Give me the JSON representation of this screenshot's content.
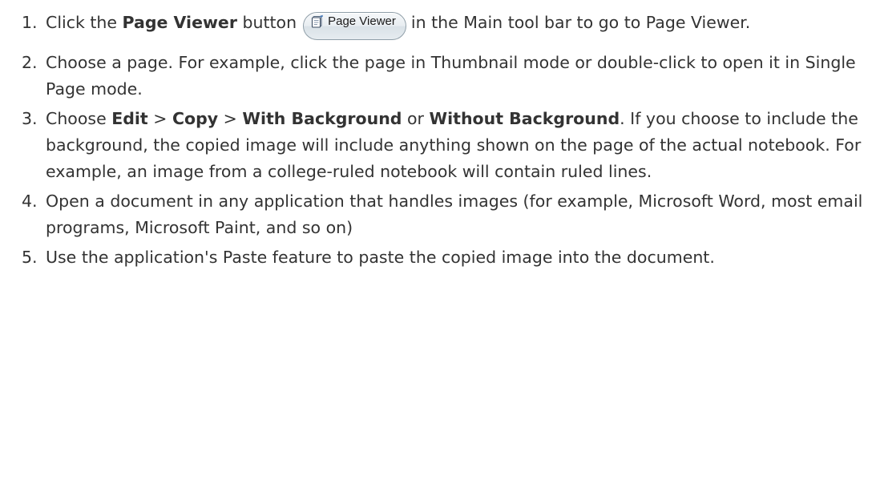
{
  "steps": [
    {
      "number": "1.",
      "t1": "Click the ",
      "b1": "Page Viewer",
      "t2": " button",
      "button_label": "Page Viewer",
      "button_icon": "notebook-icon",
      "t3": "in the Main tool bar to go to Page Viewer."
    },
    {
      "number": "2.",
      "text": "Choose a page. For example, click the page in Thumbnail mode or double-click to open it in Single Page mode."
    },
    {
      "number": "3.",
      "t1": "Choose ",
      "b1": "Edit",
      "t2": " > ",
      "b2": "Copy",
      "t3": " > ",
      "b3": "With Background",
      "t4": " or ",
      "b4": "Without Background",
      "t5": ". If you choose to include the background, the copied image will include anything shown on the page of the actual notebook. For example, an image from a college-ruled notebook will contain ruled lines."
    },
    {
      "number": "4.",
      "text": "Open a document in any application that handles images (for example, Microsoft Word, most email programs, Microsoft Paint, and so on)"
    },
    {
      "number": "5.",
      "text": "Use the application's Paste feature to paste the copied image into the document."
    }
  ]
}
